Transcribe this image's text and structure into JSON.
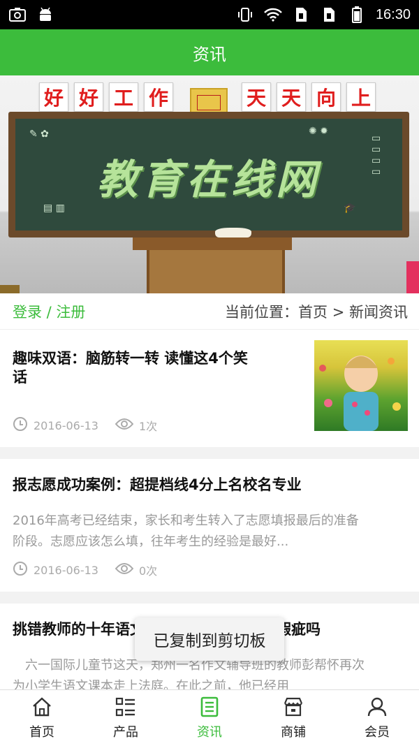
{
  "status_bar": {
    "time": "16:30",
    "icons_left": [
      "screenshot-icon",
      "android-icon"
    ],
    "icons_right": [
      "vibrate-icon",
      "wifi-icon",
      "sim1-icon",
      "sim2-icon",
      "battery-icon"
    ]
  },
  "header": {
    "title": "资讯"
  },
  "banner": {
    "top_chars": [
      "好",
      "好",
      "工",
      "作",
      "天",
      "天",
      "向",
      "上"
    ],
    "board_title": "教育在线网"
  },
  "breadcrumb": {
    "login_label": "登录 / 注册",
    "position_label": "当前位置：首页 > 新闻资讯"
  },
  "articles": [
    {
      "title_line1": "趣味双语：脑筋转一转 读懂这4个笑",
      "title_line2": "话",
      "date": "2016-06-13",
      "views": "1次",
      "has_thumb": true
    },
    {
      "title": "报志愿成功案例：超提档线4分上名校名专业",
      "summary_line1": "2016年高考已经结束，家长和考生转入了志愿填报最后的准备",
      "summary_line2": "阶段。志愿应该怎么填，往年考生的经验是最好...",
      "date": "2016-06-13",
      "views": "0次"
    },
    {
      "title": "挑错教师的十年语文路：小学语文教材存瑕疵吗",
      "summary_line1": "　六一国际儿童节这天，郑州一名作文辅导班的教师彭帮怀再次",
      "summary_line2": "为小学生语文课本走上法庭。在此之前，他已经用"
    }
  ],
  "toast": {
    "text": "已复制到剪切板"
  },
  "bottom_nav": [
    {
      "label": "首页",
      "icon": "home-icon",
      "active": false
    },
    {
      "label": "产品",
      "icon": "list-icon",
      "active": false
    },
    {
      "label": "资讯",
      "icon": "news-icon",
      "active": true
    },
    {
      "label": "商铺",
      "icon": "shop-icon",
      "active": false
    },
    {
      "label": "会员",
      "icon": "user-icon",
      "active": false
    }
  ],
  "colors": {
    "accent": "#3cbc3c",
    "muted_text": "#999999"
  }
}
